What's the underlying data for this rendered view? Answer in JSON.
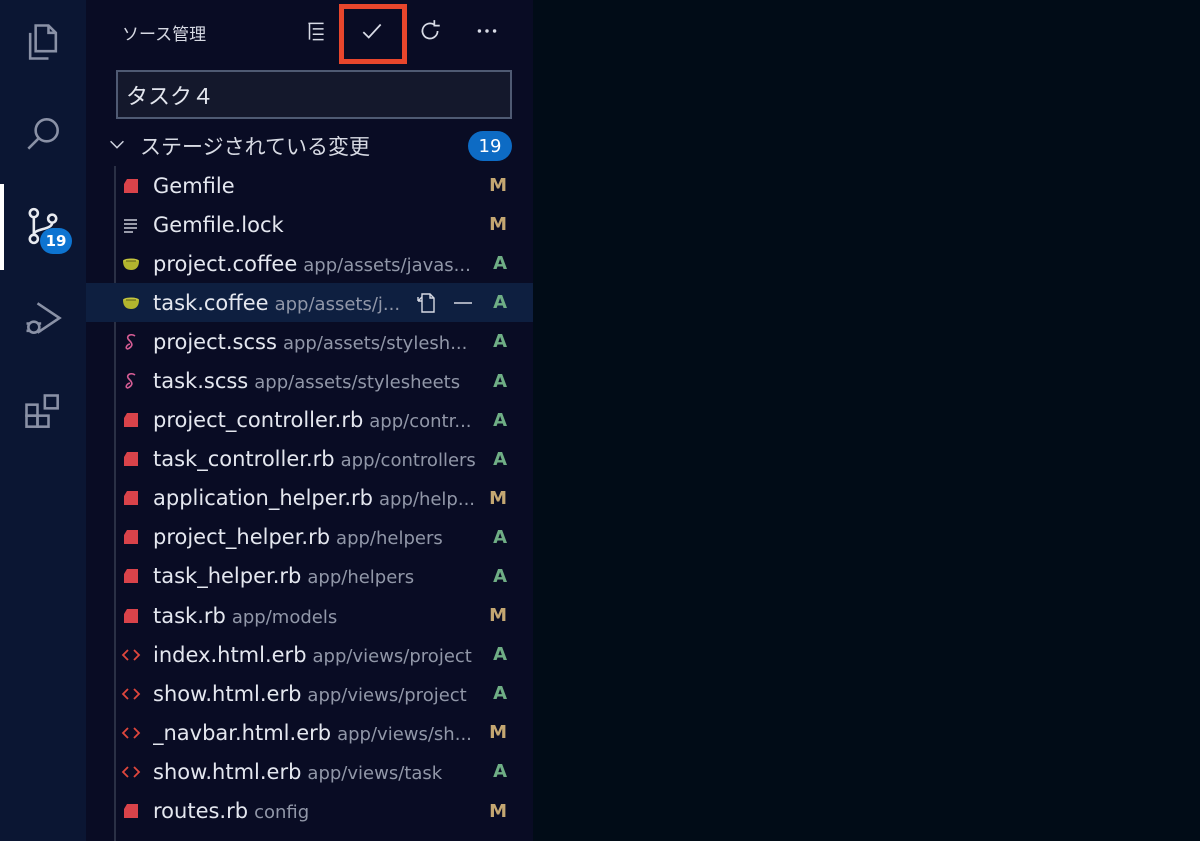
{
  "activity_bar": {
    "items": [
      {
        "icon": "files-icon"
      },
      {
        "icon": "search-icon"
      },
      {
        "icon": "source-control-icon",
        "badge": "19"
      },
      {
        "icon": "run-debug-icon"
      },
      {
        "icon": "extensions-icon"
      }
    ]
  },
  "sidebar": {
    "title": "ソース管理",
    "toolbar": [
      "view-as-tree-icon",
      "commit-check-icon",
      "refresh-icon",
      "more-icon"
    ]
  },
  "commit_input": {
    "value": "タスク４"
  },
  "staged_section": {
    "label": "ステージされている変更",
    "count": "19"
  },
  "files": [
    {
      "name": "Gemfile",
      "path": "",
      "status": "M",
      "icon": "ruby-icon"
    },
    {
      "name": "Gemfile.lock",
      "path": "",
      "status": "M",
      "icon": "text-file-icon"
    },
    {
      "name": "project.coffee",
      "path": "app/assets/javas...",
      "status": "A",
      "icon": "coffee-icon"
    },
    {
      "name": "task.coffee",
      "path": "app/assets/j...",
      "status": "A",
      "icon": "coffee-icon",
      "selected": true
    },
    {
      "name": "project.scss",
      "path": "app/assets/stylesh...",
      "status": "A",
      "icon": "sass-icon"
    },
    {
      "name": "task.scss",
      "path": "app/assets/stylesheets",
      "status": "A",
      "icon": "sass-icon"
    },
    {
      "name": "project_controller.rb",
      "path": "app/contr...",
      "status": "A",
      "icon": "ruby-icon"
    },
    {
      "name": "task_controller.rb",
      "path": "app/controllers",
      "status": "A",
      "icon": "ruby-icon"
    },
    {
      "name": "application_helper.rb",
      "path": "app/help...",
      "status": "M",
      "icon": "ruby-icon"
    },
    {
      "name": "project_helper.rb",
      "path": "app/helpers",
      "status": "A",
      "icon": "ruby-icon"
    },
    {
      "name": "task_helper.rb",
      "path": "app/helpers",
      "status": "A",
      "icon": "ruby-icon"
    },
    {
      "name": "task.rb",
      "path": "app/models",
      "status": "M",
      "icon": "ruby-icon"
    },
    {
      "name": "index.html.erb",
      "path": "app/views/project",
      "status": "A",
      "icon": "html-icon"
    },
    {
      "name": "show.html.erb",
      "path": "app/views/project",
      "status": "A",
      "icon": "html-icon"
    },
    {
      "name": "_navbar.html.erb",
      "path": "app/views/sh...",
      "status": "M",
      "icon": "html-icon"
    },
    {
      "name": "show.html.erb",
      "path": "app/views/task",
      "status": "A",
      "icon": "html-icon"
    },
    {
      "name": "routes.rb",
      "path": "config",
      "status": "M",
      "icon": "ruby-icon"
    }
  ],
  "colors": {
    "accent": "#0d74d1",
    "highlight": "#e8462c",
    "modified": "#c4a772",
    "added": "#6fae85"
  }
}
